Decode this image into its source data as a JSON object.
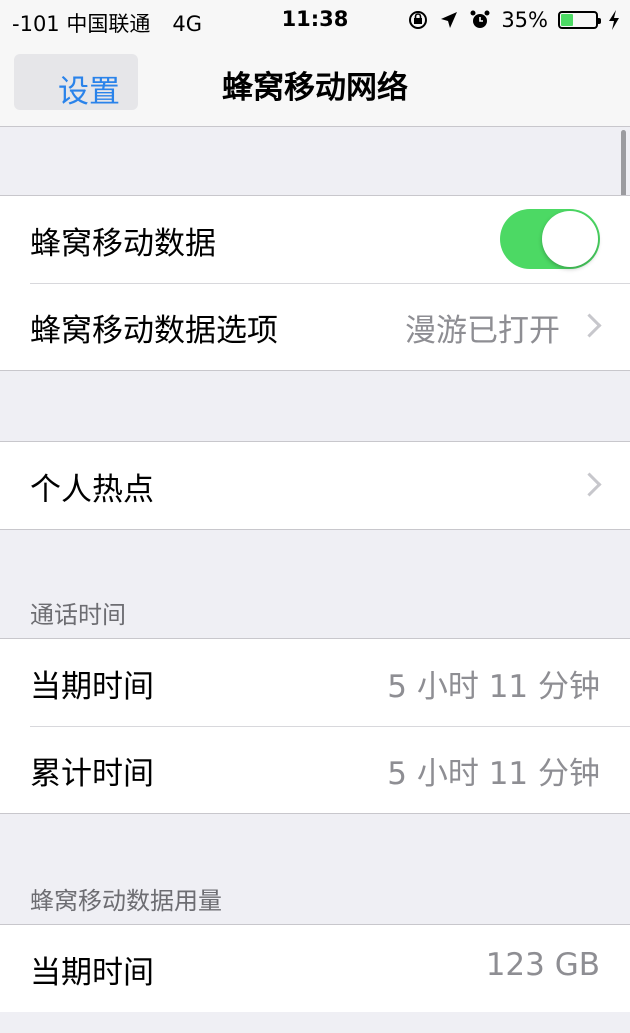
{
  "status_bar": {
    "carrier": "-101 中国联通",
    "network": "4G",
    "time": "11:38",
    "icons": [
      "rotation-lock-icon",
      "location-icon",
      "alarm-icon"
    ],
    "battery_percent": "35%",
    "battery_level": 0.35,
    "battery_color": "#4cd964"
  },
  "nav": {
    "back_label": "设置",
    "title": "蜂窝移动网络",
    "accent_color": "#2a83ea"
  },
  "group1": {
    "cellular_data_label": "蜂窝移动数据",
    "cellular_data_enabled": true,
    "cellular_options_label": "蜂窝移动数据选项",
    "cellular_options_value": "漫游已打开"
  },
  "group2": {
    "hotspot_label": "个人热点"
  },
  "call_time": {
    "header": "通话时间",
    "current_label": "当期时间",
    "current_value": "5 小时 11 分钟",
    "lifetime_label": "累计时间",
    "lifetime_value": "5 小时 11 分钟"
  },
  "data_usage": {
    "header": "蜂窝移动数据用量",
    "current_label": "当期时间",
    "current_value": "123 GB"
  }
}
